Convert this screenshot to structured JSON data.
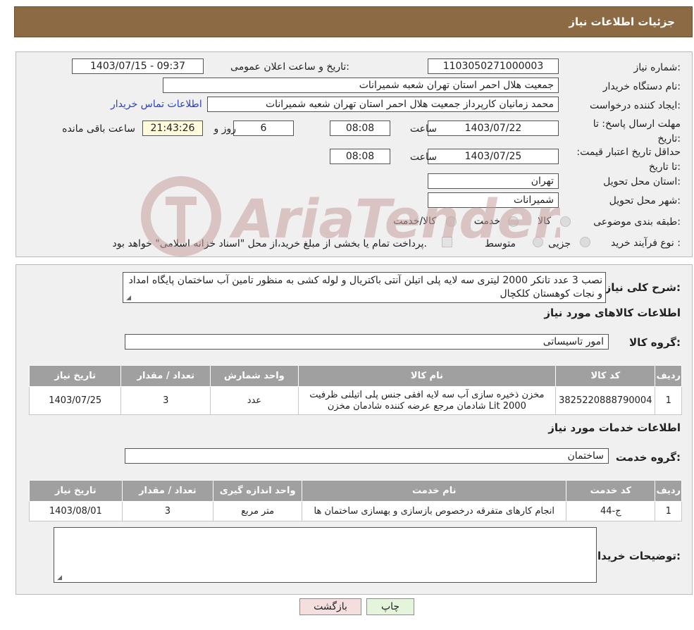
{
  "header": {
    "title": "جزئیات اطلاعات نیاز"
  },
  "info": {
    "need_number_label": "شماره نیاز:",
    "need_number": "1103050271000003",
    "announce_label": "تاریخ و ساعت اعلان عمومی:",
    "announce_value": "1403/07/15 - 09:37",
    "buyer_org_label": "نام دستگاه خریدار:",
    "buyer_org": "جمعیت هلال احمر استان تهران شعبه شمیرانات",
    "creator_label": "ایجاد کننده درخواست:",
    "creator": "محمد زمانیان کارپرداز جمعیت هلال احمر استان تهران شعبه شمیرانات",
    "contact_link": "اطلاعات تماس خریدار",
    "deadline_label": "مهلت ارسال پاسخ: تا تاریخ:",
    "deadline_date": "1403/07/22",
    "time_label": "ساعت",
    "deadline_time": "08:08",
    "days_value": "6",
    "days_label": "روز و",
    "remaining_time": "21:43:26",
    "remaining_label": "ساعت باقی مانده",
    "validity_label": "حداقل تاریخ اعتبار قیمت: تا تاریخ:",
    "validity_date": "1403/07/25",
    "validity_time": "08:08",
    "province_label": "استان محل تحویل:",
    "province": "تهران",
    "city_label": "شهر محل تحویل:",
    "city": "شمیرانات",
    "category_label": "طبقه بندی موضوعی:",
    "category_options": [
      "کالا",
      "خدمت",
      "کالا/خدمت"
    ],
    "process_label": "نوع فرآیند خرید :",
    "process_options": [
      "جزیی",
      "متوسط"
    ],
    "process_note": "پرداخت تمام یا بخشی از مبلغ خرید،از محل \"اسناد خزانه اسلامی\" خواهد بود."
  },
  "details": {
    "description_label": "شرح کلی نیاز:",
    "description": "نصب 3 عدد تانکر 2000 لیتری سه لایه پلی اتیلن آنتی باکتریال و لوله کشی به منظور تامین آب ساختمان پایگاه امداد و نجات کوهستان کلکچال",
    "goods_title": "اطلاعات کالاهای مورد نیاز",
    "goods_group_label": "گروه کالا:",
    "goods_group": "امور تاسیساتی",
    "goods_headers": [
      "ردیف",
      "کد کالا",
      "نام کالا",
      "واحد شمارش",
      "تعداد / مقدار",
      "تاریخ نیاز"
    ],
    "goods_rows": [
      [
        "1",
        "3825220888790004",
        "مخزن ذخیره سازی آب سه لایه افقی جنس پلی اتیلنی ظرفیت 2000 Lit شادمان مرجع عرضه کننده شادمان مخزن",
        "عدد",
        "3",
        "1403/07/25"
      ]
    ],
    "services_title": "اطلاعات خدمات مورد نیاز",
    "service_group_label": "گروه خدمت:",
    "service_group": "ساختمان",
    "services_headers": [
      "ردیف",
      "کد خدمت",
      "نام خدمت",
      "واحد اندازه گیری",
      "تعداد / مقدار",
      "تاریخ نیاز"
    ],
    "services_rows": [
      [
        "1",
        "ج-44",
        "انجام کارهای متفرقه درخصوص بازسازی و بهسازی ساختمان ها",
        "متر مربع",
        "3",
        "1403/08/01"
      ]
    ],
    "buyer_notes_label": "توضیحات خریدار:",
    "buyer_notes": ""
  },
  "buttons": {
    "print": "چاپ",
    "back": "بازگشت"
  },
  "watermark": {
    "text": "AriaTender.neT",
    "color": "#c8a0a0"
  },
  "colors": {
    "header_bg": "#8b6a44",
    "table_header_bg": "#a0a0a0",
    "link": "#2a40c8",
    "back_button_bg": "#f5dede",
    "print_button_bg": "#e4f5dc"
  }
}
